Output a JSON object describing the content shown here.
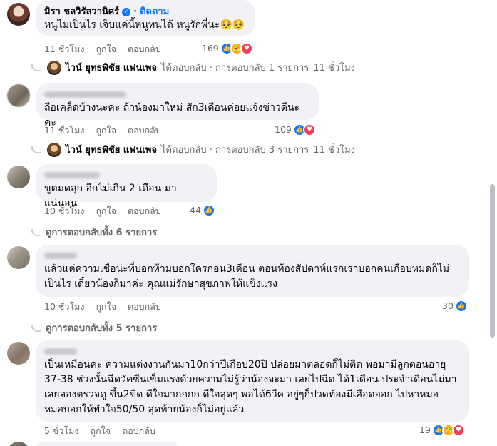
{
  "comments": [
    {
      "author": "มิรา ชลวิรัลวานิศร์",
      "follow_label": "ติดตาม",
      "text": "หนูไม่เป็นไร เจ็บแค่นี้หนูทนได้ หนูรักพี่นะ🥺🥺",
      "time": "11 ชั่วโมง",
      "like_label": "ถูกใจ",
      "reply_label": "ตอบกลับ",
      "reaction_count": "169",
      "reactions": [
        "like",
        "care",
        "love"
      ],
      "reply_summary": {
        "name": "ไวน์ ยุทธพิชัย แฟนเพจ",
        "text": "ได้ตอบกลับ · การตอบกลับ 1 รายการ",
        "time": "11 ชั่วโมง"
      }
    },
    {
      "author": "Comment author",
      "text": "ถือเคล็ดบ้างนะคะ ถ้าน้องมาใหม่ สัก3เดือนค่อยแจ้งข่าวดีนะคะ",
      "time": "11 ชั่วโมง",
      "like_label": "ถูกใจ",
      "reply_label": "ตอบกลับ",
      "reaction_count": "109",
      "reactions": [
        "like",
        "love"
      ],
      "reply_summary": {
        "name": "ไวน์ ยุทธพิชัย แฟนเพจ",
        "text": "ได้ตอบกลับ · การตอบกลับ 3 รายการ",
        "time": "11 ชั่วโมง"
      }
    },
    {
      "author": "Comment author",
      "text": "ขูตมดลุก อีกไม่เกิน 2 เดือน มาแน่นอน",
      "time": "10 ชั่วโมง",
      "like_label": "ถูกใจ",
      "reply_label": "ตอบกลับ",
      "reaction_count": "44",
      "reactions": [
        "like"
      ],
      "view_more": "ดูการตอบกลับทั้ง 6 รายการ"
    },
    {
      "author": "Comment author",
      "text_lines": [
        "แล้วแต่ความเชื่อน่ะที่บอกห้ามบอกใครก่อน3เดือน ตอนท้องสัปดาห์แรกเราบอกคนเกือบหมดก็ไม่",
        "เป็นไร เดี๋ยวน้องก็มาค่ะ คุณแม่รักษาสุขภาพให้แข็งแรง"
      ],
      "time": "10 ชั่วโมง",
      "like_label": "ถูกใจ",
      "reply_label": "ตอบกลับ",
      "reaction_count": "30",
      "reactions": [
        "like"
      ],
      "view_more": "ดูการตอบกลับทั้ง 5 รายการ"
    },
    {
      "author": "Comment author",
      "text_lines": [
        "เป็นเหมือนคะ ความแต่งงานกันมา10กว่าปีเกือบ20ปี ปล่อยมาตลอดก็ไม่ติด พอมามีลูกตอนอายุ",
        "37-38 ช่วงนั้นฉีดวัคซีนเข็มแรงด้วยความไม่รู้ว่าน้องจะมา เลยไปฉีด ได้1เดือน ประจำเดือนไม่มา",
        "เลยลองตรวจดู ขึ้น2ขีด ดีใจมากกกก ดีใจสุดๆ พอได้6วีค อยู่ๆก็ปวดท้องมีเลือดออก ไปหาหมอ",
        "หมอบอกให้ทำใจ50/50 สุดท้ายน้องก็ไม่อยู่แล้ว"
      ],
      "time": "5 ชั่วโมง",
      "like_label": "ถูกใจ",
      "reply_label": "ตอบกลับ",
      "reaction_count": "19",
      "reactions": [
        "like",
        "care",
        "love"
      ]
    }
  ]
}
